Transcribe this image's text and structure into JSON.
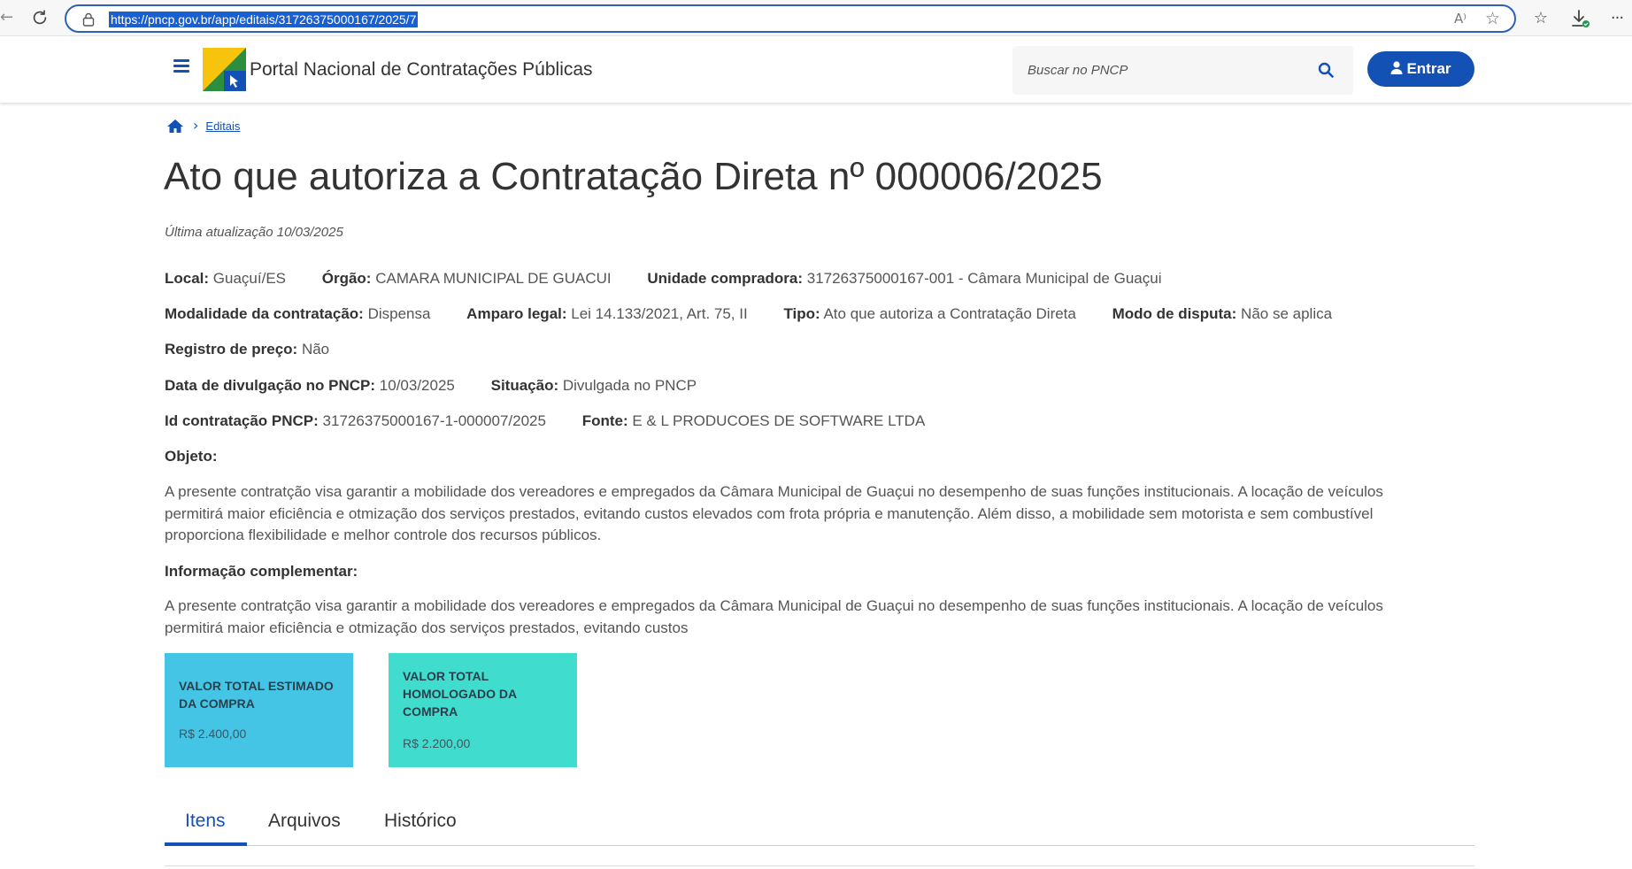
{
  "browser": {
    "url": "https://pncp.gov.br/app/editais/31726375000167/2025/7",
    "read_aloud_label": "A⁾"
  },
  "header": {
    "portal_title": "Portal Nacional de Contratações Públicas",
    "search_placeholder": "Buscar no PNCP",
    "login_label": "Entrar"
  },
  "breadcrumb": {
    "editais": "Editais"
  },
  "page": {
    "title": "Ato que autoriza a Contratação Direta nº 000006/2025",
    "last_update": "Última atualização 10/03/2025"
  },
  "details": {
    "local": {
      "label": "Local:",
      "value": "Guaçuí/ES"
    },
    "orgao": {
      "label": "Órgão:",
      "value": "CAMARA MUNICIPAL DE GUACUI"
    },
    "unidade": {
      "label": "Unidade compradora:",
      "value": "31726375000167-001 - Câmara Municipal de Guaçui"
    },
    "modalidade": {
      "label": "Modalidade da contratação:",
      "value": "Dispensa"
    },
    "amparo": {
      "label": "Amparo legal:",
      "value": "Lei 14.133/2021, Art. 75, II"
    },
    "tipo": {
      "label": "Tipo:",
      "value": "Ato que autoriza a Contratação Direta"
    },
    "modo_disputa": {
      "label": "Modo de disputa:",
      "value": "Não se aplica"
    },
    "registro_preco": {
      "label": "Registro de preço:",
      "value": "Não"
    },
    "data_divulgacao": {
      "label": "Data de divulgação no PNCP:",
      "value": "10/03/2025"
    },
    "situacao": {
      "label": "Situação:",
      "value": "Divulgada no PNCP"
    },
    "id_contratacao": {
      "label": "Id contratação PNCP:",
      "value": "31726375000167-1-000007/2025"
    },
    "fonte": {
      "label": "Fonte:",
      "value": "E & L PRODUCOES DE SOFTWARE LTDA"
    }
  },
  "objeto": {
    "label": "Objeto:",
    "text": "A presente contratção visa garantir a mobilidade dos vereadores e empregados da Câmara Municipal de Guaçui no desempenho de suas funções institucionais. A locação de veículos permitirá maior eficiência e otmização dos serviços prestados, evitando custos elevados com frota própria e manutenção. Além disso, a mobilidade sem motorista e sem combustível proporciona flexibilidade e melhor controle dos recursos públicos."
  },
  "informacao": {
    "label": "Informação complementar:",
    "text": "A presente contratção visa garantir a mobilidade dos vereadores e empregados da Câmara Municipal de Guaçui no desempenho de suas funções institucionais. A locação de veículos permitirá maior eficiência e otmização dos serviços prestados, evitando custos"
  },
  "cards": {
    "estimado": {
      "title": "VALOR TOTAL ESTIMADO DA COMPRA",
      "value": "R$ 2.400,00"
    },
    "homologado": {
      "title": "VALOR TOTAL HOMOLOGADO DA COMPRA",
      "value": "R$ 2.200,00"
    }
  },
  "tabs": {
    "itens": "Itens",
    "arquivos": "Arquivos",
    "historico": "Histórico"
  },
  "colors": {
    "brand_blue": "#1351b4",
    "card_estimado": "#45c5e6",
    "card_homologado": "#40ddcf"
  }
}
